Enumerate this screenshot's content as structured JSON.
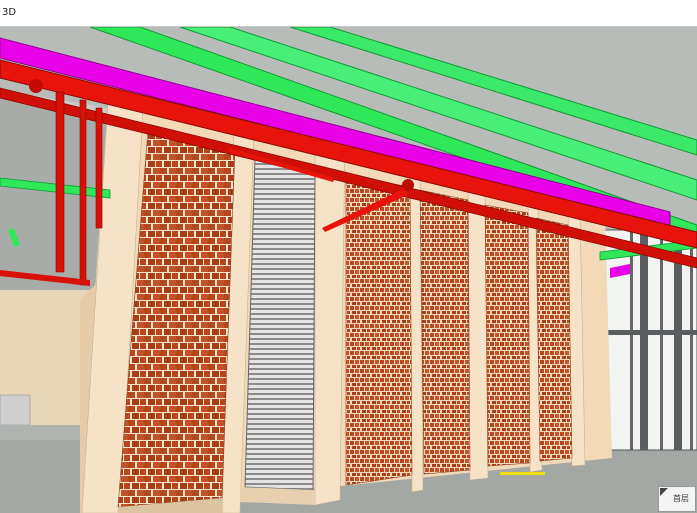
{
  "window": {
    "title": "3D"
  },
  "view_cube": {
    "label": "首层"
  },
  "colors": {
    "pipe_red": "#e8140c",
    "duct_magenta": "#e800e8",
    "duct_green": "#2ee85a",
    "brick": "#b8461c",
    "wall_beige": "#f2d9b8",
    "louver_gray": "#9a9a9a",
    "floor_yellow": "#f0e000"
  },
  "icons": [
    "view-cube-corner-icon"
  ]
}
